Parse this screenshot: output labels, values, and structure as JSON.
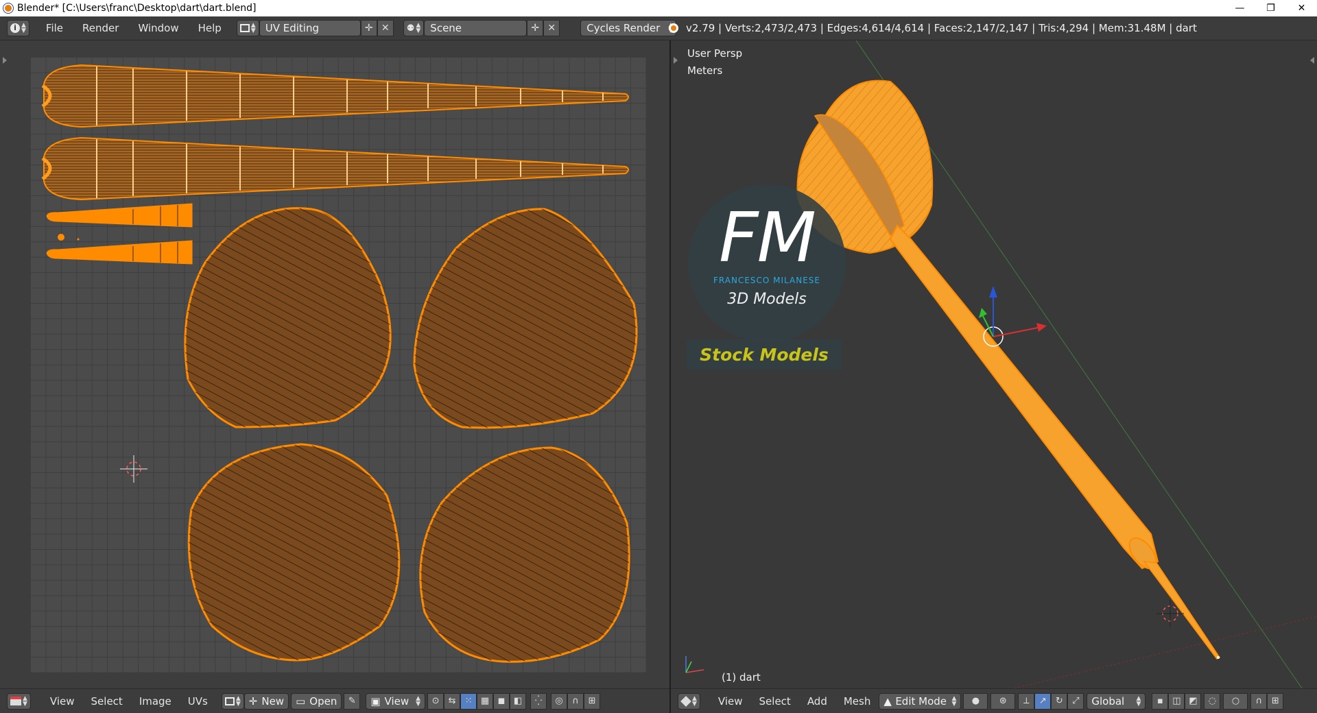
{
  "window": {
    "title": "Blender* [C:\\Users\\franc\\Desktop\\dart\\dart.blend]",
    "minimize": "—",
    "restore": "❐",
    "close": "✕"
  },
  "topbar": {
    "menu": [
      "File",
      "Render",
      "Window",
      "Help"
    ],
    "screen_layout": "UV Editing",
    "scene": "Scene",
    "render_engine": "Cycles Render",
    "stats": "v2.79 | Verts:2,473/2,473 | Edges:4,614/4,614 | Faces:2,147/2,147 | Tris:4,294 | Mem:31.48M | dart"
  },
  "uv_editor": {
    "menu": [
      "View",
      "Select",
      "Image",
      "UVs"
    ],
    "new_label": "New",
    "open_label": "Open",
    "view_label": "View"
  },
  "viewport": {
    "view_name": "User Persp",
    "units": "Meters",
    "object_label": "(1) dart",
    "menu": [
      "View",
      "Select",
      "Add",
      "Mesh"
    ],
    "mode": "Edit Mode",
    "orientation": "Global"
  },
  "watermark": {
    "logo_letters": "FM",
    "name": "FRANCESCO MILANESE",
    "tagline": "3D Models",
    "banner": "Stock Models"
  },
  "colors": {
    "uv_orange": "#ff8c00",
    "uv_fill": "#8a5a2b",
    "mesh_orange": "#f7a22c",
    "active_blue": "#5680c2",
    "logo_blue": "#2aa9e0",
    "banner_text": "#c9c41a"
  }
}
